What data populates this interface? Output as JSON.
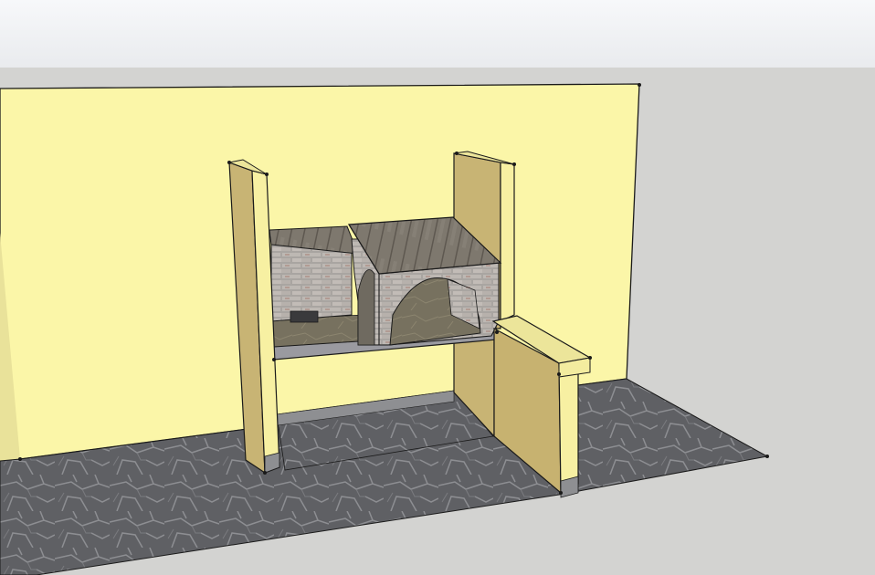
{
  "viewport": {
    "sky_color": "#eef0f3",
    "ground_color": "#d3d3d1"
  },
  "model": {
    "subject": "outdoor-kitchen-grill-model",
    "colors": {
      "back_wall": "#fbf6a8",
      "pillar_front": "#f7f0a2",
      "pillar_side": "#c8b474",
      "counter_side": "#c7b270",
      "floor": "#5e5f63",
      "brick": "#b2aeaa",
      "roof_wood": "#7d776d",
      "slab": "#9a9aa0",
      "edge": "#1a1a1a"
    }
  }
}
